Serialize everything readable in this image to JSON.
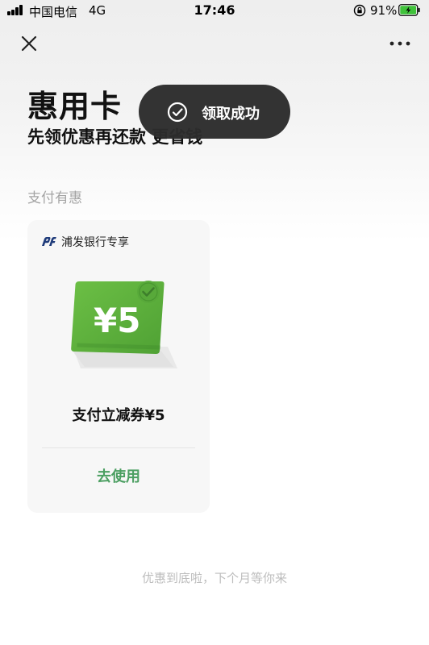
{
  "status_bar": {
    "carrier": "中国电信",
    "network": "4G",
    "time": "17:46",
    "battery": "91%"
  },
  "nav": {
    "close_icon": "close-icon",
    "more_icon": "more-icon"
  },
  "header": {
    "title": "惠用卡",
    "subtitle": "先领优惠再还款 更省钱"
  },
  "toast": {
    "text": "领取成功",
    "icon": "check-circle-icon"
  },
  "section": {
    "label": "支付有惠"
  },
  "coupon": {
    "bank": "浦发银行专享",
    "amount_label": "¥5",
    "name": "支付立减券¥5",
    "action_label": "去使用",
    "accent_color": "#5aab3e"
  },
  "footer": {
    "note": "优惠到底啦，下个月等你来"
  },
  "colors": {
    "action": "#4c9f62",
    "toast_bg": "#2c2c2c",
    "coupon_green": "#5aab3e"
  }
}
